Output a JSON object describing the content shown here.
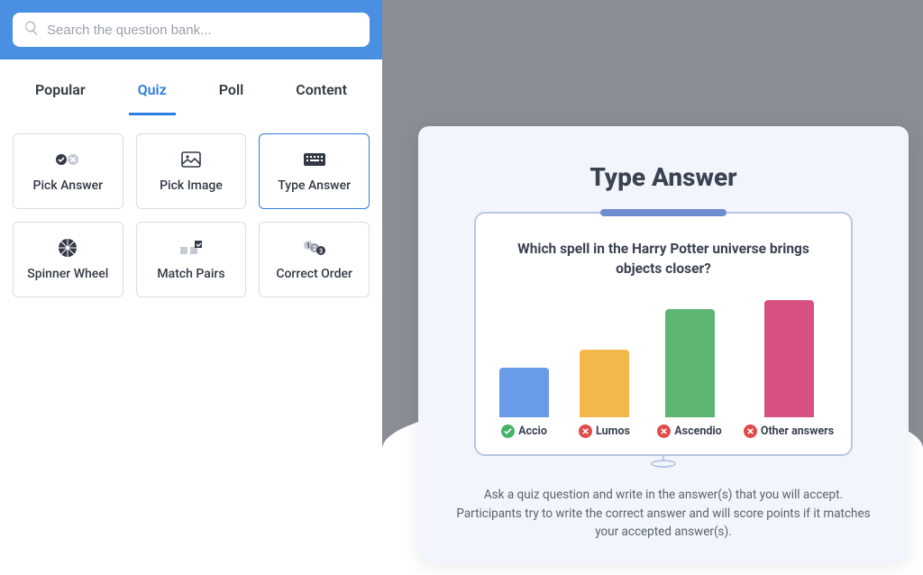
{
  "search": {
    "placeholder": "Search the question bank..."
  },
  "tabs": [
    {
      "label": "Popular",
      "active": false
    },
    {
      "label": "Quiz",
      "active": true
    },
    {
      "label": "Poll",
      "active": false
    },
    {
      "label": "Content",
      "active": false
    }
  ],
  "cards": [
    {
      "id": "pick-answer",
      "label": "Pick Answer",
      "icon": "check-x-icon",
      "selected": false
    },
    {
      "id": "pick-image",
      "label": "Pick Image",
      "icon": "image-icon",
      "selected": false
    },
    {
      "id": "type-answer",
      "label": "Type Answer",
      "icon": "keyboard-icon",
      "selected": true
    },
    {
      "id": "spinner-wheel",
      "label": "Spinner Wheel",
      "icon": "wheel-icon",
      "selected": false
    },
    {
      "id": "match-pairs",
      "label": "Match Pairs",
      "icon": "pairs-icon",
      "selected": false
    },
    {
      "id": "correct-order",
      "label": "Correct Order",
      "icon": "order-icon",
      "selected": false
    }
  ],
  "preview": {
    "title": "Type Answer",
    "question": "Which spell in the Harry Potter universe brings objects closer?",
    "description": "Ask a quiz question and write in the answer(s) that you will accept. Participants try to write the correct answer and will score points if it matches your accepted answer(s)."
  },
  "chart_data": {
    "type": "bar",
    "title": "Type Answer",
    "xlabel": "",
    "ylabel": "",
    "ylim": [
      0,
      140
    ],
    "categories": [
      "Accio",
      "Lumos",
      "Ascendio",
      "Other answers"
    ],
    "values": [
      55,
      75,
      120,
      130
    ],
    "correct": [
      true,
      false,
      false,
      false
    ],
    "colors": [
      "#6a9be8",
      "#f2b84b",
      "#5cb571",
      "#d85082"
    ]
  }
}
